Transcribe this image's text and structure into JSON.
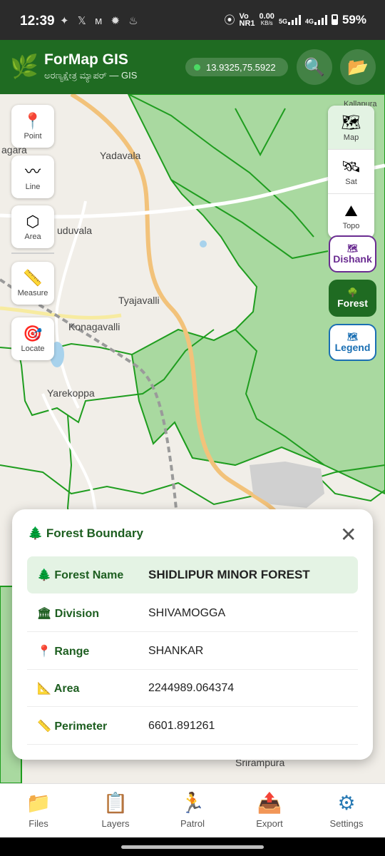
{
  "status_bar": {
    "time": "12:39",
    "notification_icons": "✦ 𝕏 ᴍ ✹ ♨",
    "volte": "Vo",
    "network": "NR1",
    "speed_value": "0.00",
    "speed_unit": "KB/s",
    "net_5g": "5G",
    "net_4g": "4G",
    "battery": "59%"
  },
  "app_header": {
    "logo_icon": "🌿",
    "title": "ForMap GIS",
    "subtitle": "ಅರಣ್ಯಕ್ಷೇತ್ರ ಮ್ಯಾಪರ್ — GIS",
    "coordinates": "13.9325,75.5922",
    "search_icon": "🔍",
    "folder_icon": "📂"
  },
  "map": {
    "places": {
      "agara": "agara",
      "yadavala": "Yadavala",
      "uduvala": "uduvala",
      "tyajavalli": "Tyajavalli",
      "konagavalli": "Konagavalli",
      "yarekoppa": "Yarekoppa",
      "srirampura": "Srirampura",
      "kallapura": "Kallapura"
    }
  },
  "tools": {
    "point": {
      "icon": "📍",
      "label": "Point"
    },
    "line": {
      "icon": "〰",
      "label": "Line"
    },
    "area": {
      "icon": "⬡",
      "label": "Area"
    },
    "measure": {
      "icon": "📏",
      "label": "Measure"
    },
    "locate": {
      "icon": "🎯",
      "label": "Locate"
    }
  },
  "layers": {
    "map": {
      "icon": "🗺",
      "label": "Map"
    },
    "sat": {
      "icon": "🛰",
      "label": "Sat"
    },
    "topo": {
      "icon": "⛰",
      "label": "Topo"
    }
  },
  "overlays": {
    "dishank": {
      "icon": "🗺",
      "label": "Dishank"
    },
    "forest": {
      "icon": "🌳",
      "label": "Forest"
    },
    "legend": {
      "icon": "🗺",
      "label": "Legend"
    }
  },
  "boundary_sheet": {
    "title": "🌲 Forest Boundary",
    "close_icon": "✕",
    "rows": [
      {
        "icon": "🌲",
        "label": "Forest Name",
        "value": "SHIDLIPUR MINOR FOREST"
      },
      {
        "icon": "🏛",
        "label": "Division",
        "value": "SHIVAMOGGA"
      },
      {
        "icon": "📍",
        "label": "Range",
        "value": "SHANKAR"
      },
      {
        "icon": "📐",
        "label": "Area",
        "value": "2244989.064374"
      },
      {
        "icon": "📏",
        "label": "Perimeter",
        "value": "6601.891261"
      }
    ]
  },
  "bottom_nav": [
    {
      "icon": "📁",
      "label": "Files"
    },
    {
      "icon": "📋",
      "label": "Layers"
    },
    {
      "icon": "🏃",
      "label": "Patrol"
    },
    {
      "icon": "📤",
      "label": "Export"
    },
    {
      "icon": "⚙",
      "label": "Settings"
    }
  ],
  "colors": {
    "brand_green": "#1f6b22",
    "forest_fill": "#a9d9a0",
    "forest_outline": "#1f9d1f",
    "dishank_accent": "#6a2c91",
    "legend_accent": "#1a6fb3"
  }
}
